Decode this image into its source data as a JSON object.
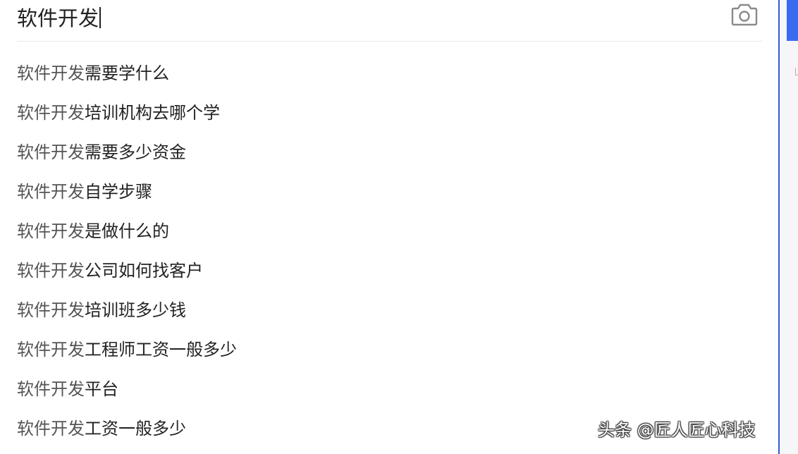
{
  "search": {
    "query": "软件开发",
    "camera_icon": "camera-icon"
  },
  "suggestions": [
    {
      "prefix": "软件开发",
      "suffix": "需要学什么"
    },
    {
      "prefix": "软件开发",
      "suffix": "培训机构去哪个学"
    },
    {
      "prefix": "软件开发",
      "suffix": "需要多少资金"
    },
    {
      "prefix": "软件开发",
      "suffix": "自学步骤"
    },
    {
      "prefix": "软件开发",
      "suffix": "是做什么的"
    },
    {
      "prefix": "软件开发",
      "suffix": "公司如何找客户"
    },
    {
      "prefix": "软件开发",
      "suffix": "培训班多少钱"
    },
    {
      "prefix": "软件开发",
      "suffix": "工程师工资一般多少"
    },
    {
      "prefix": "软件开发",
      "suffix": "平台"
    },
    {
      "prefix": "软件开发",
      "suffix": "工资一般多少"
    }
  ],
  "watermark": "头条 @匠人匠心科技",
  "colors": {
    "accent": "#3a6af0",
    "prefix_text": "#555555",
    "suffix_text": "#222222",
    "divider": "#e9e9ec"
  }
}
